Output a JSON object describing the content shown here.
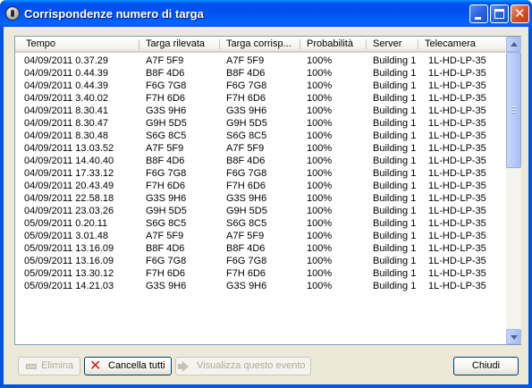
{
  "window": {
    "title": "Corrispondenze numero di targa"
  },
  "table": {
    "columns": [
      "Tempo",
      "Targa rilevata",
      "Targa corrisp...",
      "Probabilità",
      "Server",
      "Telecamera"
    ],
    "rows": [
      [
        "04/09/2011 0.37.29",
        "A7F 5F9",
        "A7F 5F9",
        "100%",
        "Building 1",
        "1L-HD-LP-35"
      ],
      [
        "04/09/2011 0.44.39",
        "B8F 4D6",
        "B8F 4D6",
        "100%",
        "Building 1",
        "1L-HD-LP-35"
      ],
      [
        "04/09/2011 0.44.39",
        "F6G 7G8",
        "F6G 7G8",
        "100%",
        "Building 1",
        "1L-HD-LP-35"
      ],
      [
        "04/09/2011 3.40.02",
        "F7H 6D6",
        "F7H 6D6",
        "100%",
        "Building 1",
        "1L-HD-LP-35"
      ],
      [
        "04/09/2011 8.30.41",
        "G3S 9H6",
        "G3S 9H6",
        "100%",
        "Building 1",
        "1L-HD-LP-35"
      ],
      [
        "04/09/2011 8.30.47",
        "G9H 5D5",
        "G9H 5D5",
        "100%",
        "Building 1",
        "1L-HD-LP-35"
      ],
      [
        "04/09/2011 8.30.48",
        "S6G 8C5",
        "S6G 8C5",
        "100%",
        "Building 1",
        "1L-HD-LP-35"
      ],
      [
        "04/09/2011 13.03.52",
        "A7F 5F9",
        "A7F 5F9",
        "100%",
        "Building 1",
        "1L-HD-LP-35"
      ],
      [
        "04/09/2011 14.40.40",
        "B8F 4D6",
        "B8F 4D6",
        "100%",
        "Building 1",
        "1L-HD-LP-35"
      ],
      [
        "04/09/2011 17.33.12",
        "F6G 7G8",
        "F6G 7G8",
        "100%",
        "Building 1",
        "1L-HD-LP-35"
      ],
      [
        "04/09/2011 20.43.49",
        "F7H 6D6",
        "F7H 6D6",
        "100%",
        "Building 1",
        "1L-HD-LP-35"
      ],
      [
        "04/09/2011 22.58.18",
        "G3S 9H6",
        "G3S 9H6",
        "100%",
        "Building 1",
        "1L-HD-LP-35"
      ],
      [
        "04/09/2011 23.03.26",
        "G9H 5D5",
        "G9H 5D5",
        "100%",
        "Building 1",
        "1L-HD-LP-35"
      ],
      [
        "05/09/2011 0.20.11",
        "S6G 8C5",
        "S6G 8C5",
        "100%",
        "Building 1",
        "1L-HD-LP-35"
      ],
      [
        "05/09/2011 3.01.48",
        "A7F 5F9",
        "A7F 5F9",
        "100%",
        "Building 1",
        "1L-HD-LP-35"
      ],
      [
        "05/09/2011 13.16.09",
        "B8F 4D6",
        "B8F 4D6",
        "100%",
        "Building 1",
        "1L-HD-LP-35"
      ],
      [
        "05/09/2011 13.16.09",
        "F6G 7G8",
        "F6G 7G8",
        "100%",
        "Building 1",
        "1L-HD-LP-35"
      ],
      [
        "05/09/2011 13.30.12",
        "F7H 6D6",
        "F7H 6D6",
        "100%",
        "Building 1",
        "1L-HD-LP-35"
      ],
      [
        "05/09/2011 14.21.03",
        "G3S 9H6",
        "G3S 9H6",
        "100%",
        "Building 1",
        "1L-HD-LP-35"
      ]
    ]
  },
  "buttons": {
    "delete_label": "Elimina",
    "clear_all_label": "Cancella tutti",
    "view_event_label": "Visualizza questo evento",
    "close_label": "Chiudi"
  },
  "icons": {
    "app": "plate-recognition-icon",
    "clear_all": "red-x-icon",
    "view_event": "arrow-right-icon",
    "delete": "minus-icon"
  },
  "colors": {
    "titlebar": "#0053ee",
    "dialog_bg": "#ece9d8",
    "clear_all_icon": "#d41919"
  }
}
